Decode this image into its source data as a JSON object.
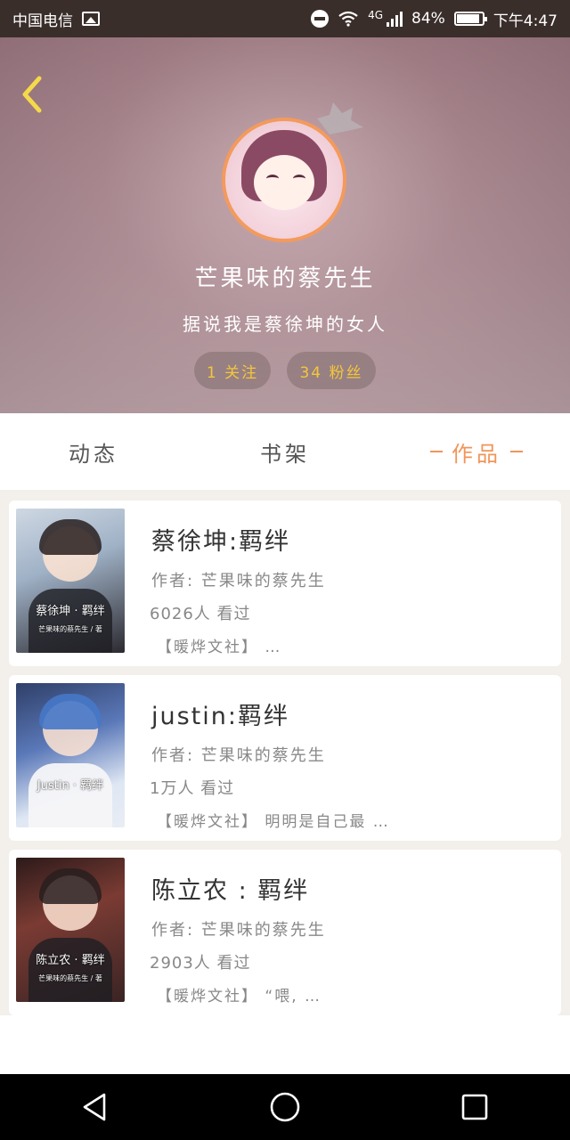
{
  "status_bar": {
    "carrier": "中国电信",
    "network": "4G",
    "battery": "84%",
    "time": "下午4:47"
  },
  "profile": {
    "username": "芒果味的蔡先生",
    "bio": "据说我是蔡徐坤的女人",
    "following": "1 关注",
    "fans": "34 粉丝"
  },
  "tabs": [
    {
      "label": "动态",
      "active": false
    },
    {
      "label": "书架",
      "active": false
    },
    {
      "label": "作品",
      "active": true
    }
  ],
  "works": [
    {
      "title": "蔡徐坤:羁绊",
      "author": "作者: 芒果味的蔡先生",
      "views": "6026人 看过",
      "excerpt": "【暖烨文社】 …",
      "cover_text": "蔡徐坤 · 羁绊",
      "cover_sub": "芒果味的蔡先生 / 著"
    },
    {
      "title": "justin:羁绊",
      "author": "作者: 芒果味的蔡先生",
      "views": "1万人 看过",
      "excerpt": "【暖烨文社】 明明是自己最 …",
      "cover_text": "Justin · 羁绊",
      "cover_sub": ""
    },
    {
      "title": "陈立农 : 羁绊",
      "author": "作者: 芒果味的蔡先生",
      "views": "2903人 看过",
      "excerpt": "【暖烨文社】 “喂, …",
      "cover_text": "陈立农 · 羁绊",
      "cover_sub": "芒果味的蔡先生 / 著"
    }
  ],
  "colors": {
    "accent": "#f0955a",
    "pill_text": "#f4c63a",
    "back_arrow": "#f4d94a"
  },
  "icons": {
    "back": "chevron-left-icon",
    "nav_back": "triangle-back-icon",
    "nav_home": "circle-home-icon",
    "nav_recent": "square-recent-icon"
  }
}
